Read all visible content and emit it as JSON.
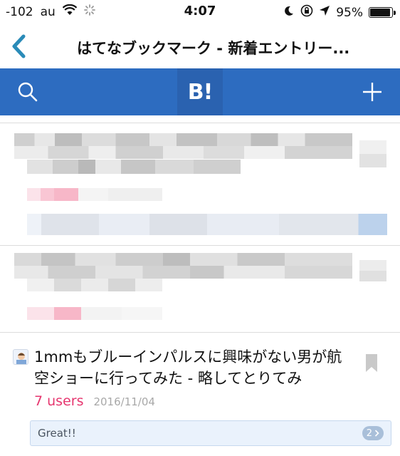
{
  "status_bar": {
    "signal": "-102",
    "carrier": "au",
    "time": "4:07",
    "battery_percent": "95%",
    "battery_level": 0.95
  },
  "nav": {
    "title": "はてなブックマーク - 新着エントリー..."
  },
  "toolbar": {
    "logo": "B!",
    "color": "#2d6cc0"
  },
  "entry": {
    "title": "1mmもブルーインパルスに興味がない男が航空ショーに行ってみた - 略してとりてみ",
    "users": "7 users",
    "date": "2016/11/04",
    "comment": "Great!!",
    "comment_count": "2",
    "users_color": "#e6366f"
  },
  "icons": [
    "chevron-left-icon",
    "search-icon",
    "plus-icon",
    "bookmark-icon",
    "wifi-icon",
    "location-arrow-icon",
    "moon-icon",
    "lock-rotation-icon"
  ]
}
